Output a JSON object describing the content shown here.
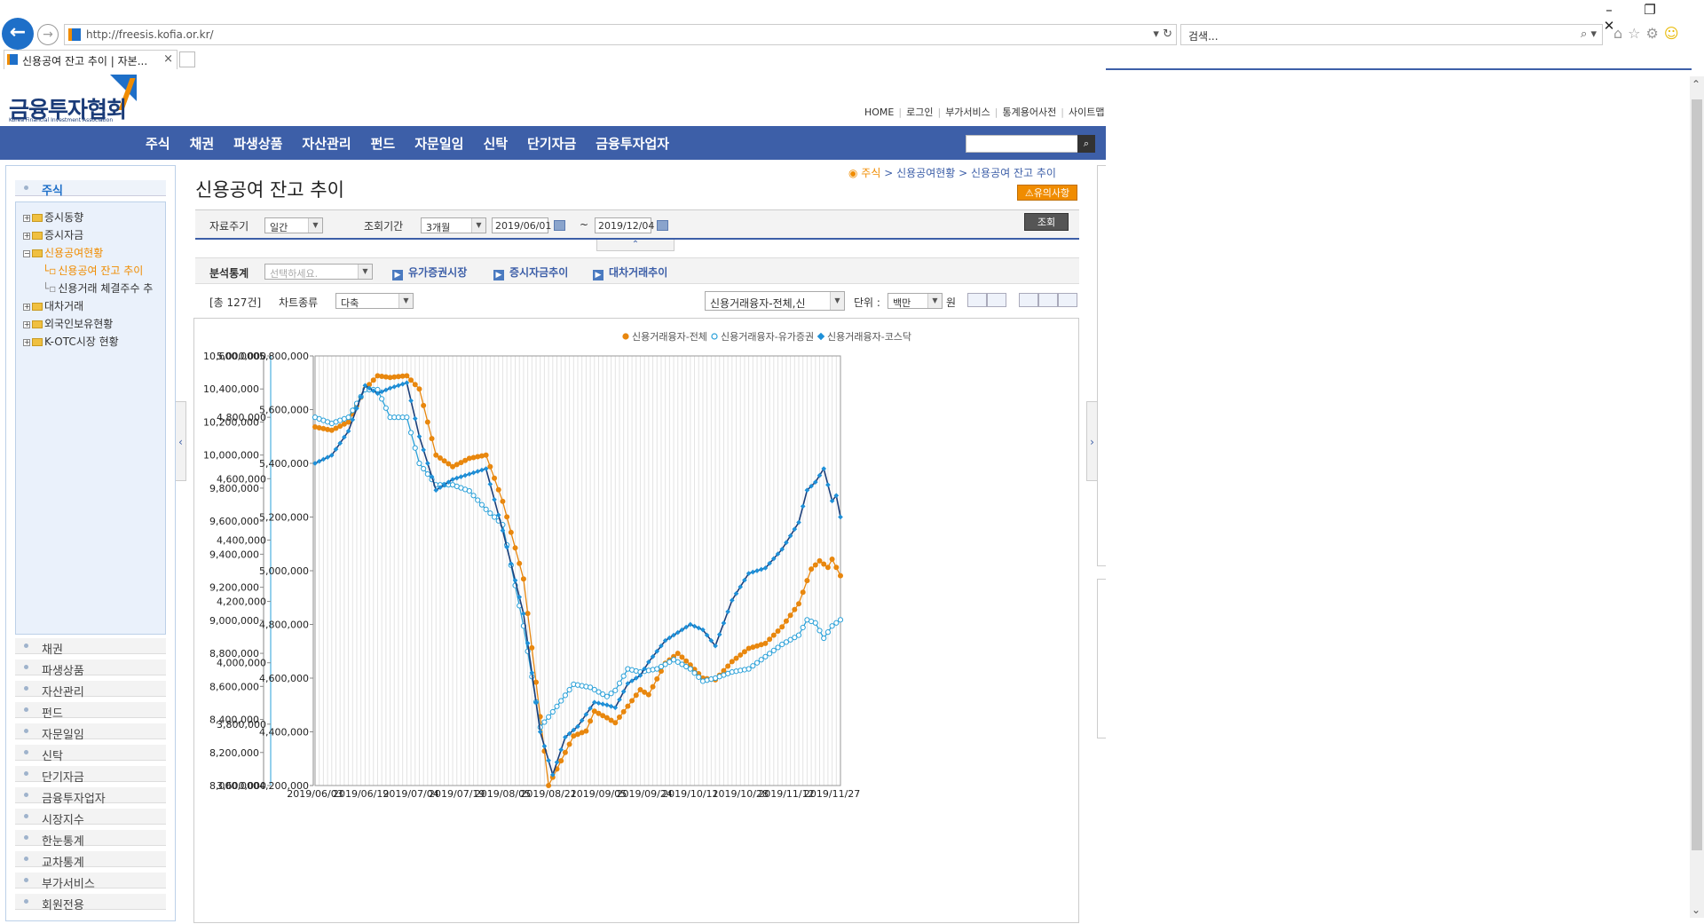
{
  "browser": {
    "url": "http://freesis.kofia.or.kr/",
    "search_placeholder": "검색...",
    "tab_title": "신용공여 잔고 추이 | 자본...",
    "tab_close": "×"
  },
  "site": {
    "logo_text": "금융투자협회",
    "logo_sub": "Korea Financial Investment Association",
    "util_links": [
      "HOME",
      "로그인",
      "부가서비스",
      "통계용어사전",
      "사이트맵"
    ],
    "gnb": [
      "주식",
      "채권",
      "파생상품",
      "자산관리",
      "펀드",
      "자문일임",
      "신탁",
      "단기자금",
      "금융투자업자"
    ]
  },
  "lnb": {
    "main_title": "주식",
    "tree": [
      "증시동향",
      "증시자금",
      "신용공여현황",
      "대차거래",
      "외국인보유현황",
      "K-OTC시장 현황"
    ],
    "tree_sub": [
      "신용공여 잔고 추이",
      "신용거래 체결주수 추"
    ],
    "categories": [
      "채권",
      "파생상품",
      "자산관리",
      "펀드",
      "자문일임",
      "신탁",
      "단기자금",
      "금융투자업자",
      "시장지수",
      "한눈통계",
      "교차통계",
      "부가서비스",
      "회원전용"
    ]
  },
  "content": {
    "breadcrumb_home": "주식",
    "breadcrumb_rest": "> 신용공여현황 > 신용공여 잔고 추이",
    "page_title": "신용공여 잔고 추이",
    "notice_btn": "⚠유의사항",
    "search": {
      "period_label": "자료주기",
      "period_value": "일간",
      "range_label": "조회기간",
      "range_value": "3개월",
      "date_from": "2019/06/01",
      "date_to": "2019/12/04",
      "tilde": "~",
      "query_btn": "조회"
    },
    "analysis": {
      "label": "분석통계",
      "select_placeholder": "선택하세요.",
      "links": [
        "유가증권시장",
        "증시자금추이",
        "대차거래추이"
      ]
    },
    "toolbar": {
      "total": "[총 127건]",
      "chart_type_label": "차트종류",
      "chart_type_value": "다축",
      "series_select": "신용거래융자-전체,신",
      "unit_label": "단위 :",
      "unit_value": "백만",
      "unit_suffix": "원"
    }
  },
  "chart_data": {
    "type": "line",
    "legend_position": "top-right",
    "grid": true,
    "x_ticks": [
      "2019/06/03",
      "2019/06/19",
      "2019/07/04",
      "2019/07/19",
      "2019/08/05",
      "2019/08/21",
      "2019/09/05",
      "2019/09/24",
      "2019/10/11",
      "2019/10/28",
      "2019/11/12",
      "2019/11/27"
    ],
    "n_points": 127,
    "axes": [
      {
        "id": "y1",
        "ylim": [
          8000000,
          10600000
        ],
        "ticks": [
          "10,600,000",
          "10,400,000",
          "10,200,000",
          "10,000,000",
          "9,800,000",
          "9,600,000",
          "9,400,000",
          "9,200,000",
          "9,000,000",
          "8,800,000",
          "8,600,000",
          "8,400,000",
          "8,200,000",
          "8,000,000"
        ]
      },
      {
        "id": "y2",
        "ylim": [
          3600000,
          5000000
        ],
        "ticks": [
          "5,000,000",
          "4,800,000",
          "4,600,000",
          "4,400,000",
          "4,200,000",
          "4,000,000",
          "3,800,000",
          "3,600,000"
        ]
      },
      {
        "id": "y3",
        "ylim": [
          4200000,
          5800000
        ],
        "ticks": [
          "5,800,000",
          "5,600,000",
          "5,400,000",
          "5,200,000",
          "5,000,000",
          "4,800,000",
          "4,600,000",
          "4,400,000",
          "4,200,000"
        ]
      }
    ],
    "series": [
      {
        "name": "신용거래융자-전체",
        "axis": "y1",
        "color": "#e8870e",
        "marker": "filled-circle",
        "keyframes": [
          [
            0,
            10170000
          ],
          [
            4,
            10150000
          ],
          [
            8,
            10200000
          ],
          [
            12,
            10400000
          ],
          [
            15,
            10480000
          ],
          [
            18,
            10470000
          ],
          [
            22,
            10480000
          ],
          [
            25,
            10400000
          ],
          [
            29,
            10000000
          ],
          [
            33,
            9930000
          ],
          [
            37,
            9980000
          ],
          [
            41,
            10000000
          ],
          [
            45,
            9720000
          ],
          [
            50,
            9250000
          ],
          [
            56,
            8000000
          ],
          [
            58,
            8100000
          ],
          [
            62,
            8300000
          ],
          [
            65,
            8330000
          ],
          [
            67,
            8450000
          ],
          [
            70,
            8410000
          ],
          [
            72,
            8380000
          ],
          [
            75,
            8480000
          ],
          [
            78,
            8580000
          ],
          [
            80,
            8550000
          ],
          [
            84,
            8740000
          ],
          [
            87,
            8800000
          ],
          [
            90,
            8730000
          ],
          [
            93,
            8650000
          ],
          [
            96,
            8640000
          ],
          [
            100,
            8750000
          ],
          [
            104,
            8830000
          ],
          [
            108,
            8860000
          ],
          [
            112,
            8960000
          ],
          [
            116,
            9100000
          ],
          [
            119,
            9310000
          ],
          [
            121,
            9360000
          ],
          [
            123,
            9320000
          ],
          [
            124,
            9370000
          ],
          [
            125,
            9320000
          ],
          [
            126,
            9270000
          ]
        ]
      },
      {
        "name": "신용거래융자-유가증권",
        "axis": "y2",
        "color": "#2aa0d8",
        "marker": "open-circle",
        "keyframes": [
          [
            0,
            4800000
          ],
          [
            4,
            4780000
          ],
          [
            8,
            4800000
          ],
          [
            12,
            4890000
          ],
          [
            15,
            4890000
          ],
          [
            18,
            4800000
          ],
          [
            22,
            4800000
          ],
          [
            25,
            4650000
          ],
          [
            29,
            4580000
          ],
          [
            33,
            4580000
          ],
          [
            37,
            4560000
          ],
          [
            41,
            4500000
          ],
          [
            45,
            4450000
          ],
          [
            50,
            4120000
          ],
          [
            54,
            3790000
          ],
          [
            57,
            3840000
          ],
          [
            62,
            3930000
          ],
          [
            66,
            3920000
          ],
          [
            70,
            3890000
          ],
          [
            72,
            3910000
          ],
          [
            75,
            3980000
          ],
          [
            78,
            3970000
          ],
          [
            82,
            3980000
          ],
          [
            86,
            4010000
          ],
          [
            90,
            3980000
          ],
          [
            93,
            3940000
          ],
          [
            96,
            3950000
          ],
          [
            100,
            3970000
          ],
          [
            104,
            3980000
          ],
          [
            108,
            4020000
          ],
          [
            112,
            4060000
          ],
          [
            116,
            4090000
          ],
          [
            118,
            4140000
          ],
          [
            120,
            4130000
          ],
          [
            122,
            4080000
          ],
          [
            124,
            4120000
          ],
          [
            126,
            4140000
          ]
        ]
      },
      {
        "name": "신용거래융자-코스닥",
        "axis": "y3",
        "color": "#1e90d8",
        "marker": "filled-diamond",
        "keyframes": [
          [
            0,
            5400000
          ],
          [
            4,
            5430000
          ],
          [
            8,
            5520000
          ],
          [
            12,
            5690000
          ],
          [
            15,
            5660000
          ],
          [
            18,
            5680000
          ],
          [
            22,
            5700000
          ],
          [
            25,
            5500000
          ],
          [
            29,
            5300000
          ],
          [
            33,
            5340000
          ],
          [
            37,
            5360000
          ],
          [
            41,
            5380000
          ],
          [
            45,
            5150000
          ],
          [
            50,
            4840000
          ],
          [
            54,
            4400000
          ],
          [
            57,
            4240000
          ],
          [
            60,
            4380000
          ],
          [
            63,
            4420000
          ],
          [
            67,
            4510000
          ],
          [
            70,
            4500000
          ],
          [
            72,
            4490000
          ],
          [
            75,
            4580000
          ],
          [
            78,
            4610000
          ],
          [
            80,
            4660000
          ],
          [
            84,
            4740000
          ],
          [
            87,
            4770000
          ],
          [
            90,
            4800000
          ],
          [
            93,
            4780000
          ],
          [
            96,
            4720000
          ],
          [
            100,
            4890000
          ],
          [
            104,
            4990000
          ],
          [
            108,
            5010000
          ],
          [
            112,
            5080000
          ],
          [
            116,
            5180000
          ],
          [
            118,
            5300000
          ],
          [
            120,
            5330000
          ],
          [
            122,
            5380000
          ],
          [
            124,
            5260000
          ],
          [
            125,
            5280000
          ],
          [
            126,
            5200000
          ]
        ]
      }
    ]
  },
  "colors": {
    "accent": "#3d5fa8",
    "highlight": "#f08c00"
  },
  "icons": {
    "back": "←",
    "forward": "→",
    "refresh": "↻",
    "search": "⌕",
    "home": "⌂",
    "star": "☆",
    "gear": "⚙",
    "smile": "☺",
    "minimize": "–",
    "restore": "❐",
    "close": "✕"
  }
}
